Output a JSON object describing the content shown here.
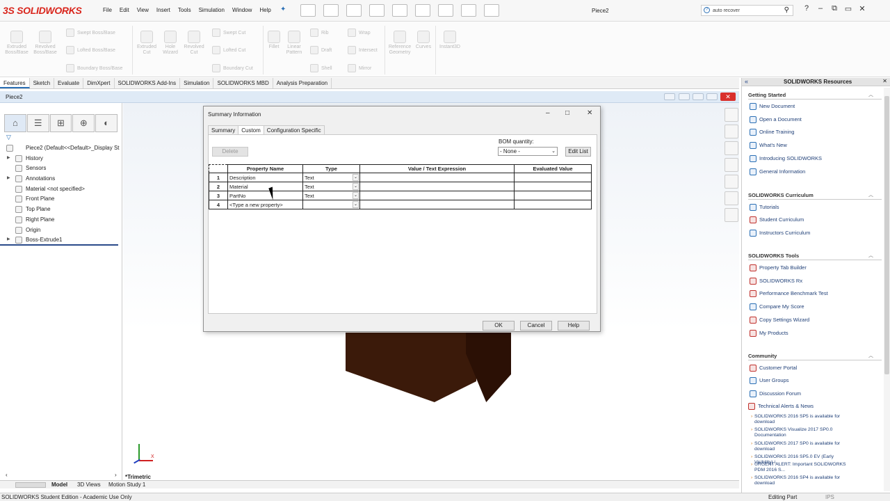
{
  "app": {
    "logo_text": "SOLIDWORKS",
    "menu": [
      "File",
      "Edit",
      "View",
      "Insert",
      "Tools",
      "Simulation",
      "Window",
      "Help"
    ],
    "doc_title": "Piece2",
    "search": {
      "value": "auto recover"
    }
  },
  "command_manager": {
    "items": [
      "Extruded Boss/Base",
      "Revolved Boss/Base",
      "Swept Boss/Base",
      "Lofted Boss/Base",
      "Boundary Boss/Base",
      "Extruded Cut",
      "Hole Wizard",
      "Revolved Cut",
      "Swept Cut",
      "Lofted Cut",
      "Boundary Cut",
      "Fillet",
      "Linear Pattern",
      "Rib",
      "Draft",
      "Shell",
      "Wrap",
      "Intersect",
      "Mirror",
      "Reference Geometry",
      "Curves",
      "Instant3D"
    ]
  },
  "tabs": [
    "Features",
    "Sketch",
    "Evaluate",
    "DimXpert",
    "SOLIDWORKS Add-Ins",
    "Simulation",
    "SOLIDWORKS MBD",
    "Analysis Preparation"
  ],
  "document": {
    "title": "Piece2"
  },
  "feature_tree": {
    "root": "Piece2  (Default<<Default>_Display St",
    "items": [
      "History",
      "Sensors",
      "Annotations",
      "Material <not specified>",
      "Front Plane",
      "Top Plane",
      "Right Plane",
      "Origin",
      "Boss-Extrude1"
    ]
  },
  "view": {
    "orientation": "*Trimetric",
    "x_label": "X"
  },
  "bottom_tabs": [
    "Model",
    "3D Views",
    "Motion Study 1"
  ],
  "status": {
    "left": "SOLIDWORKS Student Edition - Academic Use Only",
    "mode": "Editing Part",
    "units": "IPS"
  },
  "task_pane": {
    "title": "SOLIDWORKS Resources",
    "sections": [
      {
        "title": "Getting Started",
        "items": [
          "New Document",
          "Open a Document",
          "Online Training",
          "What's New",
          "Introducing SOLIDWORKS",
          "General Information"
        ]
      },
      {
        "title": "SOLIDWORKS Curriculum",
        "items": [
          "Tutorials",
          "Student Curriculum",
          "Instructors Curriculum"
        ]
      },
      {
        "title": "SOLIDWORKS Tools",
        "items": [
          "Property Tab Builder",
          "SOLIDWORKS Rx",
          "Performance Benchmark Test",
          "Compare My Score",
          "Copy Settings Wizard",
          "My Products"
        ]
      },
      {
        "title": "Community",
        "items": [
          "Customer Portal",
          "User Groups",
          "Discussion Forum",
          "Technical Alerts & News"
        ]
      }
    ],
    "news": [
      "SOLIDWORKS 2016 SP5 is available for download",
      "SOLIDWORKS Visualize 2017 SP0.0 Documentation",
      "SOLIDWORKS 2017 SP0 is available for download",
      "SOLIDWORKS 2016 SP5.0 EV (Early Visibility) i...",
      "URGENT ALERT: Important SOLIDWORKS PDM 2016 S...",
      "SOLIDWORKS 2016 SP4 is available for download"
    ]
  },
  "dialog": {
    "title": "Summary Information",
    "tabs": [
      "Summary",
      "Custom",
      "Configuration Specific"
    ],
    "delete_label": "Delete",
    "bom_label": "BOM quantity:",
    "bom_value": "- None -",
    "edit_list_label": "Edit List",
    "columns": [
      "Property Name",
      "Type",
      "Value / Text Expression",
      "Evaluated Value"
    ],
    "rows": [
      {
        "num": "1",
        "name": "Description",
        "type": "Text",
        "value": "",
        "evaluated": ""
      },
      {
        "num": "2",
        "name": "Material",
        "type": "Text",
        "value": "",
        "evaluated": ""
      },
      {
        "num": "3",
        "name": "PartNo",
        "type": "Text",
        "value": "",
        "evaluated": ""
      },
      {
        "num": "4",
        "name": "<Type a new property>",
        "type": "",
        "value": "",
        "evaluated": ""
      }
    ],
    "ok_label": "OK",
    "cancel_label": "Cancel",
    "help_label": "Help"
  }
}
